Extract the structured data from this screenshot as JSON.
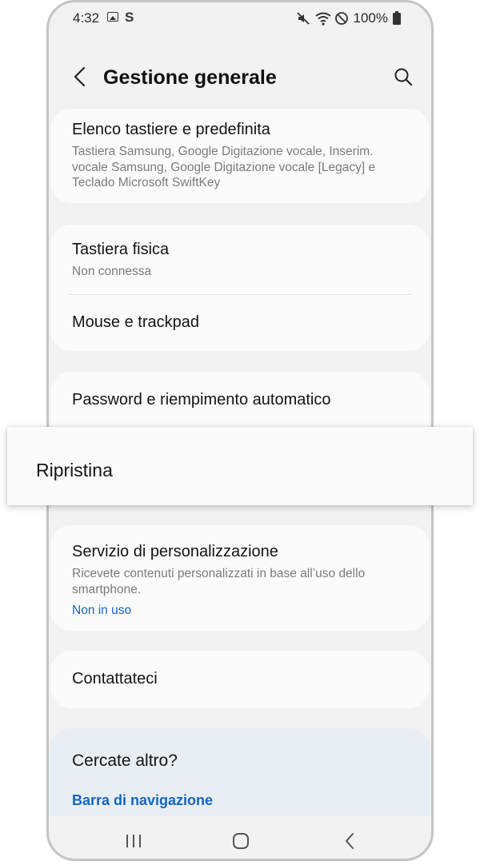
{
  "status_bar": {
    "time": "4:32",
    "carrier_glyph": "S",
    "battery_percent": "100%",
    "icons": [
      "gallery-icon",
      "mute-icon",
      "wifi-icon",
      "do-not-disturb-icon",
      "battery-icon"
    ]
  },
  "header": {
    "title": "Gestione generale",
    "back_icon": "chevron-left-icon",
    "search_icon": "search-icon"
  },
  "keyboard_card": {
    "title": "Elenco tastiere e predefinita",
    "subtitle": "Tastiera Samsung, Google Digitazione vocale, Inserim. vocale Samsung, Google Digitazione vocale [Legacy] e Teclado Microsoft SwiftKey"
  },
  "input_card": {
    "physical_keyboard_title": "Tastiera fisica",
    "physical_keyboard_status": "Non connessa",
    "mouse_title": "Mouse e trackpad"
  },
  "password_row": {
    "title": "Password e riempimento automatico"
  },
  "highlight": {
    "label": "Ripristina"
  },
  "customization_card": {
    "title": "Servizio di personalizzazione",
    "subtitle": "Ricevete contenuti personalizzati in base all’uso dello smartphone.",
    "status": "Non in uso"
  },
  "contact_row": {
    "title": "Contattateci"
  },
  "more_card": {
    "title": "Cercate altro?",
    "link": "Barra di navigazione"
  },
  "navigation_bar": {
    "buttons": [
      "recents-icon",
      "home-icon",
      "back-icon"
    ]
  },
  "colors": {
    "link_blue": "#1565c0",
    "screen_bg": "#f2f2f2",
    "card_bg": "#fbfbfb",
    "more_card_bg": "#e8eef4"
  }
}
